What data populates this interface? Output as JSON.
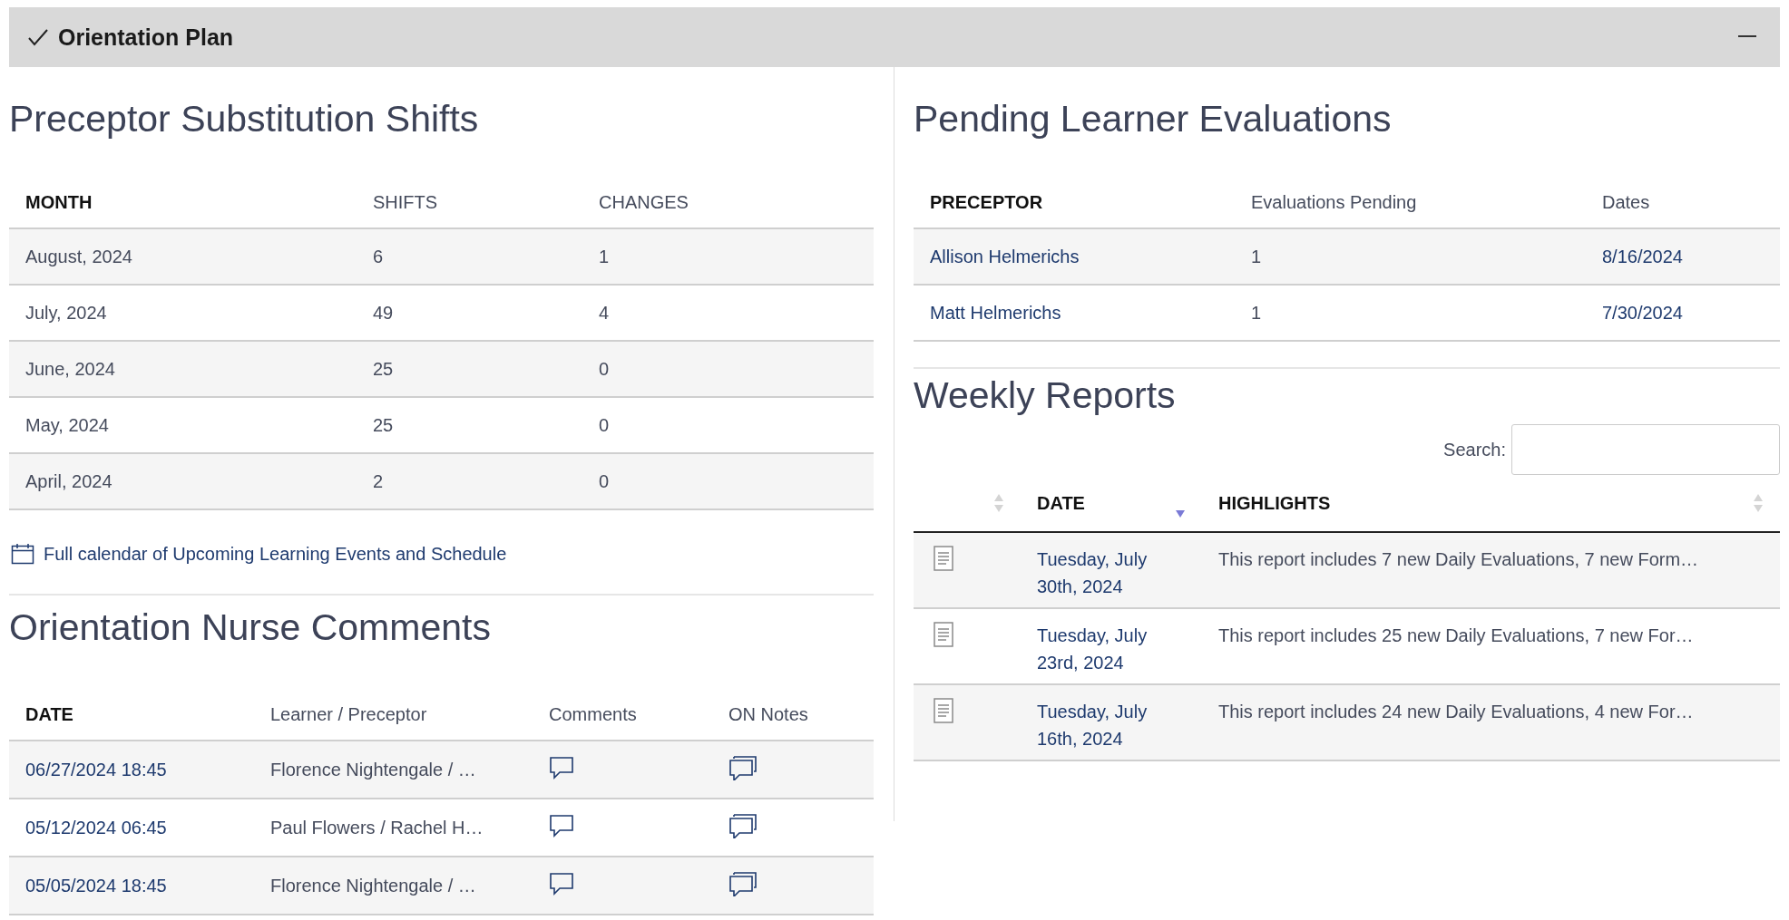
{
  "panel": {
    "title": "Orientation Plan",
    "expanded": true
  },
  "substitution_shifts": {
    "title": "Preceptor Substitution Shifts",
    "columns": [
      "MONTH",
      "SHIFTS",
      "CHANGES"
    ],
    "rows": [
      {
        "month": "August, 2024",
        "shifts": "6",
        "changes": "1"
      },
      {
        "month": "July, 2024",
        "shifts": "49",
        "changes": "4"
      },
      {
        "month": "June, 2024",
        "shifts": "25",
        "changes": "0"
      },
      {
        "month": "May, 2024",
        "shifts": "25",
        "changes": "0"
      },
      {
        "month": "April, 2024",
        "shifts": "2",
        "changes": "0"
      }
    ]
  },
  "calendar_link": "Full calendar of Upcoming Learning Events and Schedule",
  "nurse_comments": {
    "title": "Orientation Nurse Comments",
    "columns": [
      "DATE",
      "Learner / Preceptor",
      "Comments",
      "ON Notes"
    ],
    "rows": [
      {
        "date": "06/27/2024 18:45",
        "learner_preceptor": "Florence Nightengale / …"
      },
      {
        "date": "05/12/2024 06:45",
        "learner_preceptor": "Paul Flowers / Rachel H…"
      },
      {
        "date": "05/05/2024 18:45",
        "learner_preceptor": "Florence Nightengale / …"
      }
    ]
  },
  "pending_evaluations": {
    "title": "Pending Learner Evaluations",
    "columns": [
      "PRECEPTOR",
      "Evaluations Pending",
      "Dates"
    ],
    "rows": [
      {
        "preceptor": "Allison Helmerichs",
        "pending": "1",
        "dates": "8/16/2024"
      },
      {
        "preceptor": "Matt Helmerichs",
        "pending": "1",
        "dates": "7/30/2024"
      }
    ]
  },
  "weekly_reports": {
    "title": "Weekly Reports",
    "search": {
      "label": "Search:"
    },
    "columns": [
      {
        "sorted": false
      },
      {
        "label": "DATE",
        "sorted": true
      },
      {
        "label": "HIGHLIGHTS",
        "sorted": false
      }
    ],
    "rows": [
      {
        "date": "Tuesday, July 30th, 2024",
        "highlights": "This report includes 7 new Daily Evaluations, 7 new Form…"
      },
      {
        "date": "Tuesday, July 23rd, 2024",
        "highlights": "This report includes 25 new Daily Evaluations, 7 new For…"
      },
      {
        "date": "Tuesday, July 16th, 2024",
        "highlights": "This report includes 24 new Daily Evaluations, 4 new For…"
      }
    ]
  }
}
